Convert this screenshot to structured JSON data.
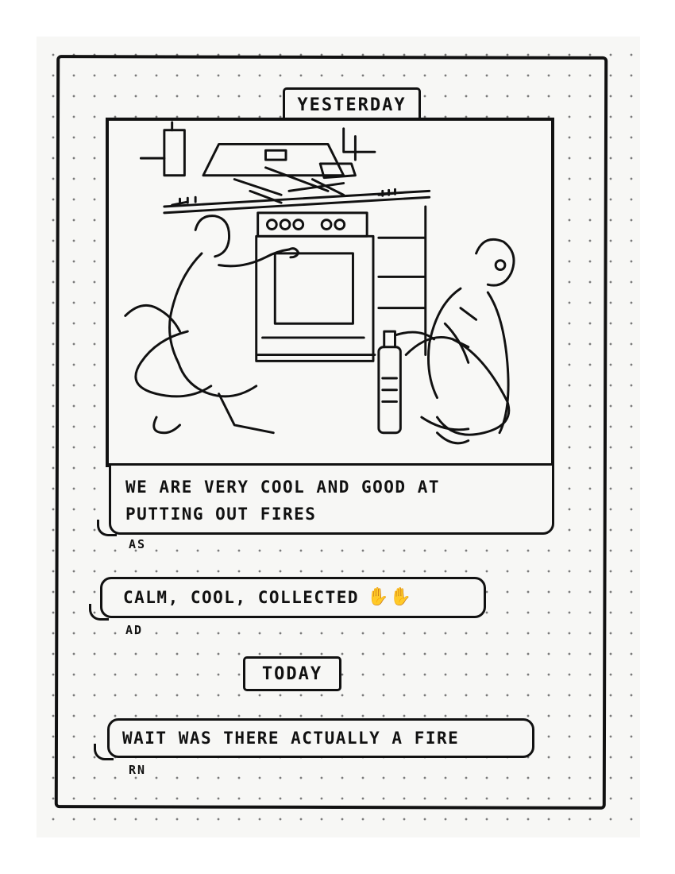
{
  "thread": {
    "day_labels": {
      "yesterday": "YESTERDAY",
      "today": "TODAY"
    },
    "messages": [
      {
        "sender": "AS",
        "text_line1": "WE ARE VERY COOL AND GOOD AT",
        "text_line2": "PUTTING OUT FIRES",
        "has_photo": true
      },
      {
        "sender": "AD",
        "text": "CALM, COOL, COLLECTED",
        "reaction_icons": [
          "waving-hand-icon",
          "waving-hand-icon"
        ]
      },
      {
        "sender": "RN",
        "text": "WAIT WAS THERE ACTUALLY A FIRE"
      }
    ]
  },
  "colors": {
    "ink": "#111111",
    "paper": "#f7f7f5",
    "dots": "#7a7a7a"
  }
}
